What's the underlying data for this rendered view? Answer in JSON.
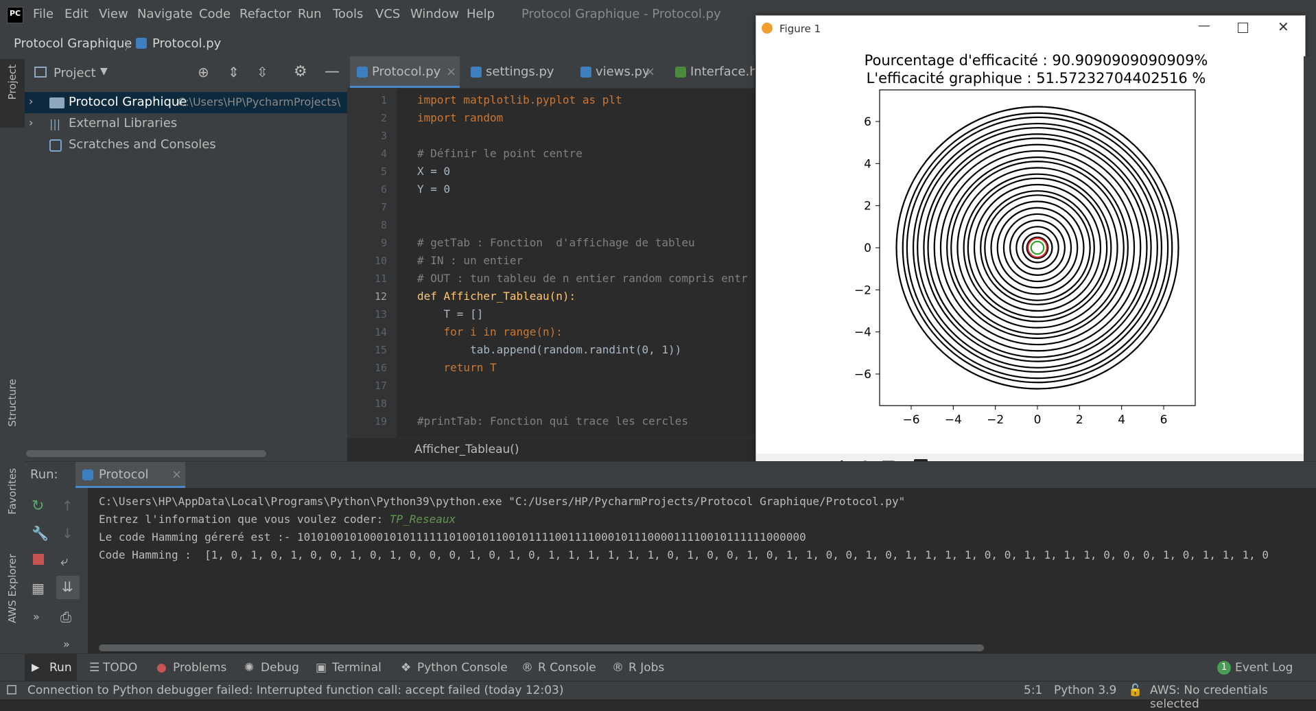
{
  "window_title": "Protocol Graphique - Protocol.py",
  "menu": [
    "File",
    "Edit",
    "View",
    "Navigate",
    "Code",
    "Refactor",
    "Run",
    "Tools",
    "VCS",
    "Window",
    "Help"
  ],
  "breadcrumb": {
    "project": "Protocol Graphique",
    "file": "Protocol.py"
  },
  "left_strip": {
    "project": "Project",
    "structure": "Structure",
    "favorites": "Favorites",
    "aws": "AWS Explorer"
  },
  "project_panel": {
    "title": "Project",
    "items": [
      {
        "label": "Protocol Graphique",
        "path": "C:\\Users\\HP\\PycharmProjects\\"
      },
      {
        "label": "External Libraries"
      },
      {
        "label": "Scratches and Consoles"
      }
    ]
  },
  "editor": {
    "tabs": [
      "Protocol.py",
      "settings.py",
      "views.py",
      "Interface.htm"
    ],
    "line_numbers": [
      "1",
      "2",
      "3",
      "4",
      "5",
      "6",
      "7",
      "8",
      "9",
      "10",
      "11",
      "12",
      "13",
      "14",
      "15",
      "16",
      "17",
      "18",
      "19"
    ],
    "lines": [
      "import matplotlib.pyplot as plt",
      "import random",
      "",
      "# Définir le point centre",
      "X = 0",
      "Y = 0",
      "",
      "",
      "# getTab : Fonction  d'affichage de tableu",
      "# IN : un entier",
      "# OUT : tun tableu de n entier random compris entr",
      "def Afficher_Tableau(n):",
      "    T = []",
      "    for i in range(n):",
      "        tab.append(random.randint(0, 1))",
      "    return T",
      "",
      "",
      "#printTab: Fonction qui trace les cercles"
    ],
    "breadcrumb_function": "Afficher_Tableau()"
  },
  "figure": {
    "window_title": "Figure 1",
    "title_line1": "Pourcentage d'efficacité : 90.9090909090909%",
    "title_line2": "L'efficacité graphique : 51.57232704402516 %"
  },
  "chart_data": {
    "type": "line",
    "title": "Pourcentage d'efficacité : 90.9090909090909%\nL'efficacité graphique : 51.57232704402516 %",
    "xlabel": "",
    "ylabel": "",
    "xlim": [
      -7.5,
      7.5
    ],
    "ylim": [
      -7.5,
      7.5
    ],
    "xticks": [
      -6,
      -4,
      -2,
      0,
      2,
      4,
      6
    ],
    "yticks": [
      -6,
      -4,
      -2,
      0,
      2,
      4,
      6
    ],
    "xtick_labels": [
      "−6",
      "−4",
      "−2",
      "0",
      "2",
      "4",
      "6"
    ],
    "ytick_labels": [
      "6",
      "4",
      "2",
      "0",
      "−2",
      "−4",
      "−6"
    ],
    "center": [
      0,
      0
    ],
    "circle_radii": [
      0.5,
      0.7,
      1.0,
      1.3,
      1.6,
      1.9,
      2.2,
      2.5,
      2.7,
      3.0,
      3.3,
      3.5,
      3.8,
      4.1,
      4.3,
      4.6,
      4.9,
      5.2,
      5.4,
      5.7,
      5.9,
      6.2,
      6.4,
      6.7
    ],
    "highlight_circles": [
      {
        "radius": 0.3,
        "color": "#2ca02c"
      },
      {
        "radius": 0.45,
        "color": "#d62728"
      }
    ],
    "grid": false
  },
  "run_panel": {
    "label": "Run:",
    "tab": "Protocol",
    "lines": [
      "C:\\Users\\HP\\AppData\\Local\\Programs\\Python\\Python39\\python.exe \"C:/Users/HP/PycharmProjects/Protocol Graphique/Protocol.py\"",
      "Entrez l'information que vous voulez coder: ",
      "Le code Hamming géreré est :- 10101001010001010111111010010110010111100111100010111000011110010111111000000",
      "Code Hamming :  [1, 0, 1, 0, 1, 0, 0, 1, 0, 1, 0, 0, 0, 1, 0, 1, 0, 1, 1, 1, 1, 1, 1, 0, 1, 0, 0, 1, 0, 1, 1, 0, 0, 1, 0, 1, 1, 1, 1, 0, 0, 1, 1, 1, 1, 0, 0, 0, 1, 0, 1, 1, 1, 0"
    ],
    "user_input": "TP_Reseaux"
  },
  "tool_windows": [
    "Run",
    "TODO",
    "Problems",
    "Debug",
    "Terminal",
    "Python Console",
    "R Console",
    "R Jobs",
    "Event Log"
  ],
  "event_log_count": "1",
  "status": {
    "message": "Connection to Python debugger failed: Interrupted function call: accept failed (today 12:03)",
    "position": "5:1",
    "interpreter": "Python 3.9",
    "aws": "AWS: No credentials selected"
  },
  "colors": {
    "accent": "#4a88c7",
    "bg": "#2b2b2b",
    "panel": "#3c3f41",
    "input": "#629755"
  }
}
